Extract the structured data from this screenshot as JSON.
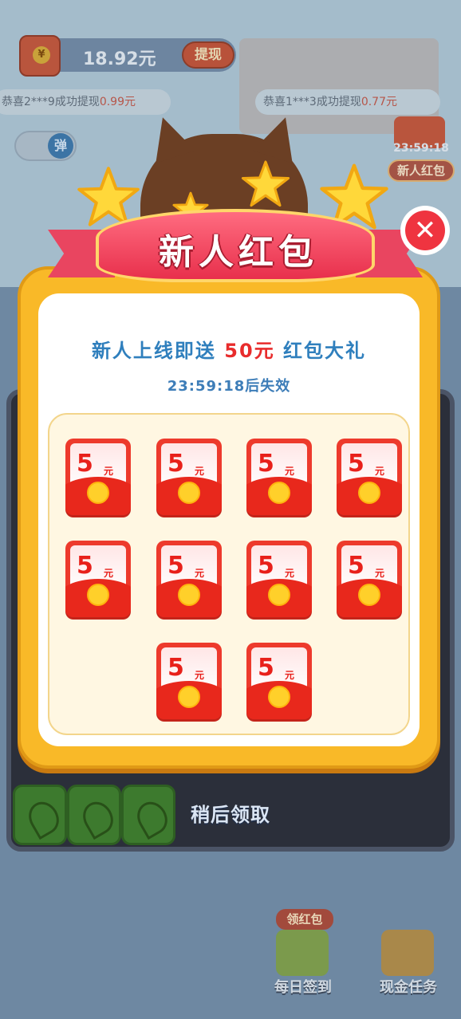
{
  "top_bar": {
    "balance": "18.92元",
    "withdraw_label": "提现"
  },
  "tickers": [
    {
      "text_pre": "恭喜2***9成功提现",
      "amount": "0.99元"
    },
    {
      "text_pre": "恭喜1***3成功提现",
      "amount": "0.77元"
    }
  ],
  "toggle_label": "弹",
  "side_promo": {
    "timer": "23:59:18",
    "label": "新人红包"
  },
  "popup": {
    "banner_title": "新人红包",
    "headline_pre": "新人上线即送 ",
    "headline_amount": "50元",
    "headline_post": " 红包大礼",
    "countdown": "23:59:18后失效",
    "envelopes": [
      {
        "amount": "5",
        "unit": "元"
      },
      {
        "amount": "5",
        "unit": "元"
      },
      {
        "amount": "5",
        "unit": "元"
      },
      {
        "amount": "5",
        "unit": "元"
      },
      {
        "amount": "5",
        "unit": "元"
      },
      {
        "amount": "5",
        "unit": "元"
      },
      {
        "amount": "5",
        "unit": "元"
      },
      {
        "amount": "5",
        "unit": "元"
      },
      {
        "amount": "5",
        "unit": "元"
      },
      {
        "amount": "5",
        "unit": "元"
      }
    ],
    "close_icon": "close-icon"
  },
  "later_label": "稍后领取",
  "bottom_bar": {
    "tag": "领红包",
    "daily_signin_label": "每日签到",
    "cash_task_label": "现金任务"
  },
  "colors": {
    "popup_frame": "#f9b928",
    "banner_red": "#e8304c",
    "envelope_red": "#ed3a2c",
    "headline_blue": "#2f7fbd",
    "amount_red": "#e82c2c"
  }
}
